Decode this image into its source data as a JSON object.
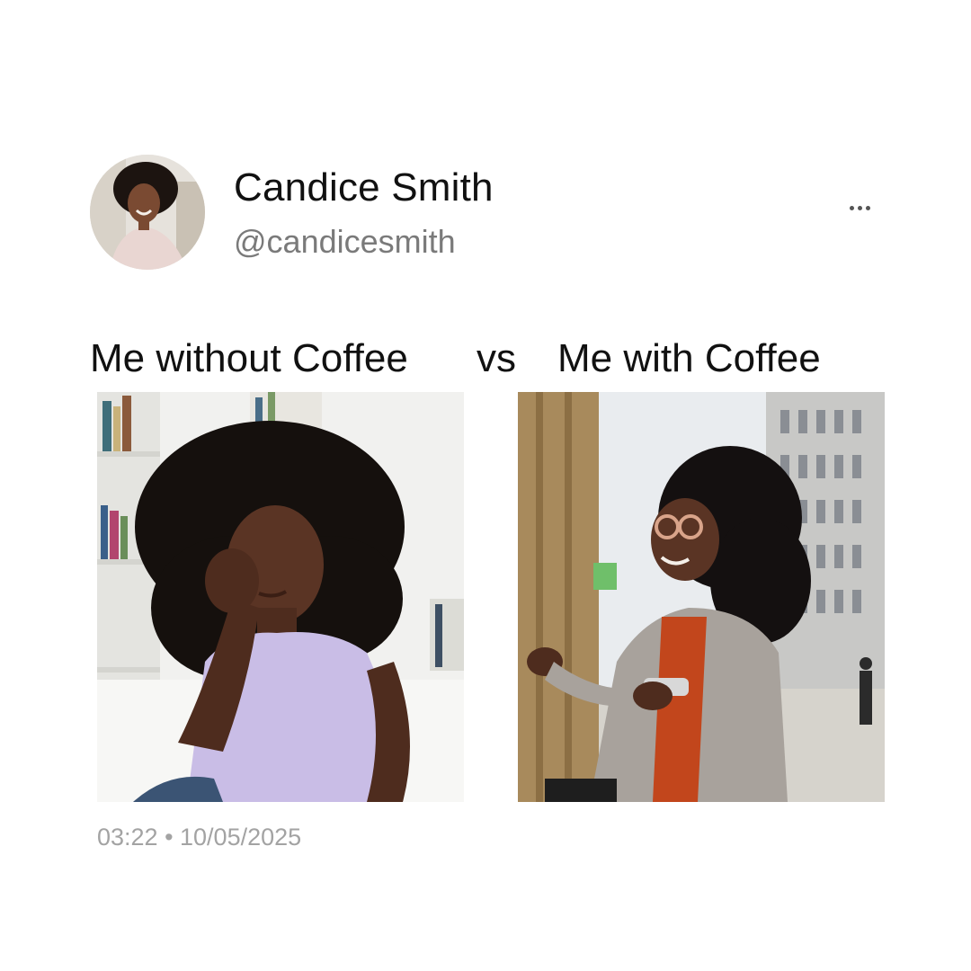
{
  "author": {
    "name": "Candice Smith",
    "handle": "@candicesmith",
    "avatar_icon": "profile-photo"
  },
  "menu": {
    "icon": "more-options-icon"
  },
  "caption": {
    "left": "Me without Coffee",
    "separator": "vs",
    "right": "Me with Coffee"
  },
  "images": {
    "left": "photo-tired-woman",
    "right": "photo-happy-woman"
  },
  "meta": {
    "timestamp": "03:22 • 10/05/2025"
  },
  "colors": {
    "name": "#111111",
    "handle": "#7a7a7a",
    "timestamp": "#a3a3a3"
  }
}
